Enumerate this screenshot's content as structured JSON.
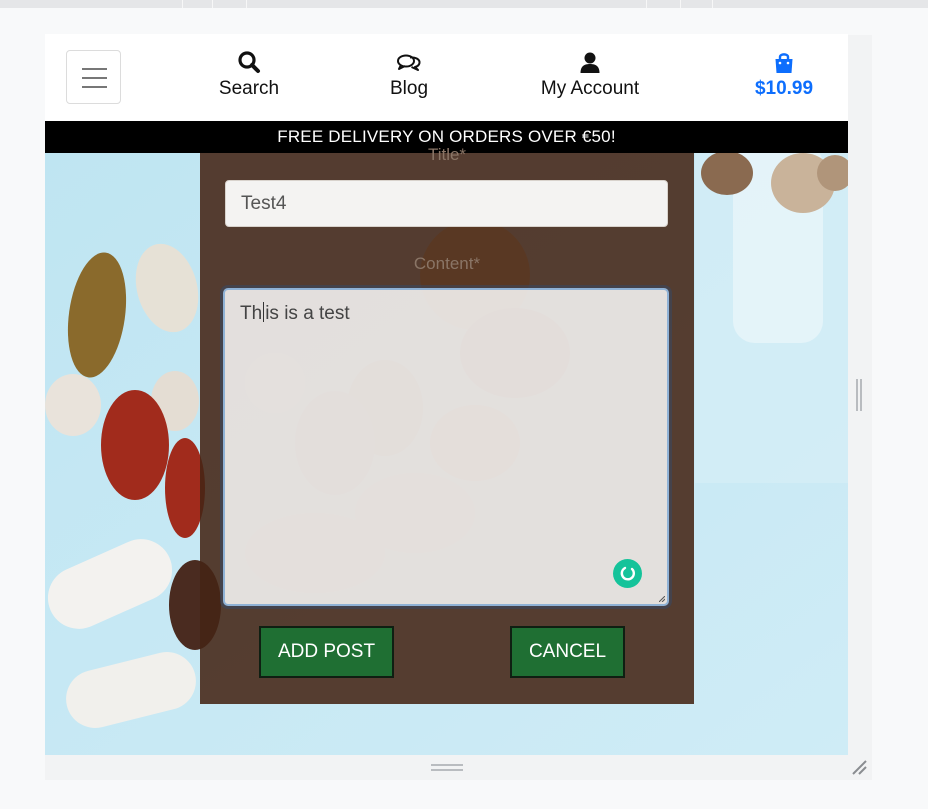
{
  "navbar": {
    "menu_icon": "hamburger-icon",
    "search": {
      "label": "Search",
      "icon": "search-icon"
    },
    "blog": {
      "label": "Blog",
      "icon": "comments-icon"
    },
    "account": {
      "label": "My Account",
      "icon": "user-icon"
    },
    "cart": {
      "label": "$10.99",
      "icon": "shopping-bag-icon",
      "color": "#0d6efd"
    }
  },
  "banner": {
    "text": "FREE DELIVERY ON ORDERS OVER €50!"
  },
  "form": {
    "title_label": "Title*",
    "title_value": "Test4",
    "content_label": "Content*",
    "content_before_caret": "Th",
    "content_after_caret": "is is a test",
    "grammar_icon": "grammarly-icon",
    "add_button": "ADD POST",
    "cancel_button": "CANCEL",
    "button_color": "#1f6f33"
  }
}
